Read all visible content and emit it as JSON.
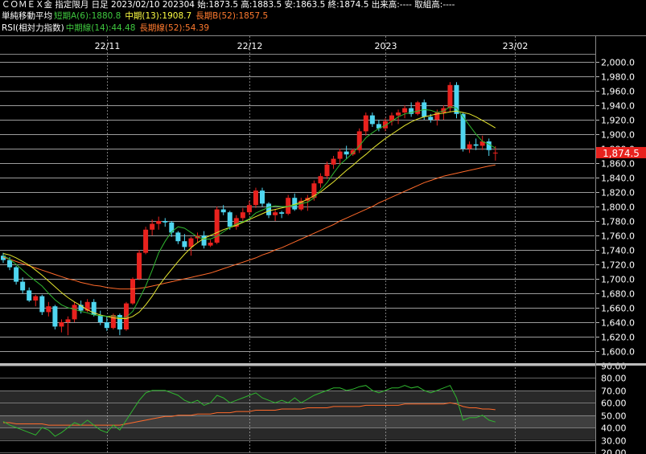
{
  "header": {
    "line1": "ＣＯＭＥＸ金 指定限月 日足 2023/02/10 202304 始:1873.5 高:1883.5 安:1863.5 終:1874.5 出来高:---- 取組高:----",
    "ma_label": "単純移動平均",
    "ma_short": "短期A(6):1880.8",
    "ma_mid": "中期(13):1908.7",
    "ma_long": "長期B(52):1857.5",
    "rsi_label": "RSI(相対力指数)",
    "rsi_value": "中期線(14):44.48",
    "rsi_signal": "長期線(52):54.39"
  },
  "colors": {
    "up": "#e8221e",
    "down": "#4fd6f0",
    "ma_short": "#2fb52f",
    "ma_mid": "#e6e62e",
    "ma_long": "#ff6a2a",
    "rsi": "#2fb52f",
    "rsi_long": "#ff6a2a",
    "price_tag": "#e8221e"
  },
  "chart_data": [
    {
      "type": "candlestick",
      "title": "ＣＯＭＥＸ金 指定限月 日足",
      "x_labels": [
        "22/11",
        "22/12",
        "2023",
        "23/02"
      ],
      "x_label_index": [
        17,
        39,
        60,
        80
      ],
      "ylim": [
        1600,
        2000
      ],
      "y_ticks": [
        2000,
        1980,
        1960,
        1940,
        1920,
        1900,
        1880,
        1860,
        1840,
        1820,
        1800,
        1780,
        1760,
        1740,
        1720,
        1700,
        1680,
        1660,
        1640,
        1620,
        1600
      ],
      "y_tick_labels": [
        "2,000.0",
        "1,980.0",
        "1,960.0",
        "1,940.0",
        "1,920.0",
        "1,900.0",
        "1,880.0",
        "1,860.0",
        "1,840.0",
        "1,820.0",
        "1,800.0",
        "1,780.0",
        "1,760.0",
        "1,740.0",
        "1,720.0",
        "1,700.0",
        "1,680.0",
        "1,660.0",
        "1,640.0",
        "1,620.0",
        "1,600.0"
      ],
      "last_price_label": "1,874.5",
      "candles": [
        [
          1,
          1732,
          1736,
          1722,
          1726
        ],
        [
          2,
          1726,
          1730,
          1712,
          1716
        ],
        [
          3,
          1716,
          1718,
          1692,
          1696
        ],
        [
          4,
          1696,
          1702,
          1680,
          1684
        ],
        [
          5,
          1684,
          1688,
          1668,
          1670
        ],
        [
          6,
          1670,
          1678,
          1662,
          1676
        ],
        [
          7,
          1676,
          1678,
          1650,
          1654
        ],
        [
          8,
          1654,
          1668,
          1648,
          1662
        ],
        [
          9,
          1662,
          1664,
          1630,
          1634
        ],
        [
          10,
          1634,
          1644,
          1626,
          1640
        ],
        [
          11,
          1640,
          1648,
          1622,
          1644
        ],
        [
          12,
          1644,
          1668,
          1640,
          1664
        ],
        [
          13,
          1664,
          1670,
          1652,
          1656
        ],
        [
          14,
          1656,
          1672,
          1654,
          1668
        ],
        [
          15,
          1668,
          1672,
          1648,
          1650
        ],
        [
          16,
          1650,
          1656,
          1636,
          1640
        ],
        [
          17,
          1640,
          1648,
          1628,
          1632
        ],
        [
          18,
          1632,
          1652,
          1630,
          1650
        ],
        [
          19,
          1650,
          1652,
          1622,
          1630
        ],
        [
          20,
          1630,
          1668,
          1628,
          1666
        ],
        [
          21,
          1666,
          1702,
          1664,
          1700
        ],
        [
          22,
          1700,
          1740,
          1698,
          1736
        ],
        [
          23,
          1736,
          1772,
          1734,
          1768
        ],
        [
          24,
          1768,
          1782,
          1760,
          1776
        ],
        [
          25,
          1776,
          1786,
          1768,
          1780
        ],
        [
          26,
          1780,
          1784,
          1772,
          1778
        ],
        [
          27,
          1778,
          1780,
          1758,
          1764
        ],
        [
          28,
          1764,
          1766,
          1748,
          1752
        ],
        [
          29,
          1752,
          1762,
          1740,
          1744
        ],
        [
          30,
          1744,
          1758,
          1732,
          1756
        ],
        [
          31,
          1756,
          1764,
          1750,
          1760
        ],
        [
          32,
          1760,
          1766,
          1742,
          1746
        ],
        [
          33,
          1746,
          1754,
          1744,
          1750
        ],
        [
          34,
          1750,
          1800,
          1748,
          1796
        ],
        [
          35,
          1796,
          1802,
          1788,
          1792
        ],
        [
          36,
          1792,
          1794,
          1768,
          1772
        ],
        [
          37,
          1772,
          1788,
          1768,
          1784
        ],
        [
          38,
          1784,
          1798,
          1780,
          1792
        ],
        [
          39,
          1792,
          1808,
          1788,
          1802
        ],
        [
          40,
          1802,
          1826,
          1798,
          1822
        ],
        [
          41,
          1822,
          1826,
          1800,
          1804
        ],
        [
          42,
          1804,
          1806,
          1784,
          1788
        ],
        [
          43,
          1788,
          1796,
          1780,
          1792
        ],
        [
          44,
          1792,
          1794,
          1784,
          1790
        ],
        [
          45,
          1790,
          1816,
          1788,
          1812
        ],
        [
          46,
          1812,
          1818,
          1794,
          1796
        ],
        [
          47,
          1796,
          1812,
          1794,
          1808
        ],
        [
          48,
          1808,
          1816,
          1794,
          1812
        ],
        [
          49,
          1812,
          1836,
          1808,
          1832
        ],
        [
          50,
          1832,
          1846,
          1826,
          1842
        ],
        [
          51,
          1842,
          1862,
          1838,
          1858
        ],
        [
          52,
          1858,
          1870,
          1852,
          1866
        ],
        [
          53,
          1866,
          1880,
          1858,
          1876
        ],
        [
          54,
          1876,
          1884,
          1866,
          1872
        ],
        [
          55,
          1872,
          1880,
          1870,
          1878
        ],
        [
          56,
          1878,
          1908,
          1874,
          1904
        ],
        [
          57,
          1904,
          1930,
          1898,
          1926
        ],
        [
          58,
          1926,
          1930,
          1910,
          1914
        ],
        [
          59,
          1914,
          1920,
          1904,
          1908
        ],
        [
          60,
          1908,
          1922,
          1904,
          1918
        ],
        [
          61,
          1918,
          1930,
          1912,
          1926
        ],
        [
          62,
          1926,
          1934,
          1914,
          1930
        ],
        [
          63,
          1930,
          1940,
          1922,
          1936
        ],
        [
          64,
          1936,
          1944,
          1924,
          1928
        ],
        [
          65,
          1928,
          1946,
          1926,
          1944
        ],
        [
          66,
          1944,
          1948,
          1920,
          1924
        ],
        [
          67,
          1924,
          1928,
          1916,
          1920
        ],
        [
          68,
          1920,
          1934,
          1912,
          1930
        ],
        [
          69,
          1930,
          1940,
          1920,
          1936
        ],
        [
          70,
          1936,
          1972,
          1930,
          1968
        ],
        [
          71,
          1968,
          1972,
          1922,
          1928
        ],
        [
          72,
          1928,
          1930,
          1876,
          1880
        ],
        [
          73,
          1880,
          1890,
          1874,
          1886
        ],
        [
          74,
          1886,
          1894,
          1878,
          1884
        ],
        [
          75,
          1884,
          1898,
          1878,
          1890
        ],
        [
          76,
          1890,
          1894,
          1870,
          1878
        ],
        [
          77,
          1873.5,
          1883.5,
          1863.5,
          1874.5
        ]
      ],
      "ma_short_values": [
        1732,
        1727,
        1720,
        1712,
        1704,
        1697,
        1690,
        1680,
        1671,
        1664,
        1660,
        1658,
        1655,
        1653,
        1650,
        1649,
        1648,
        1649,
        1646,
        1647,
        1655,
        1672,
        1690,
        1712,
        1736,
        1752,
        1765,
        1772,
        1770,
        1764,
        1758,
        1755,
        1755,
        1759,
        1765,
        1771,
        1776,
        1779,
        1783,
        1791,
        1795,
        1799,
        1801,
        1800,
        1800,
        1802,
        1804,
        1806,
        1812,
        1823,
        1833,
        1846,
        1858,
        1866,
        1874,
        1884,
        1895,
        1902,
        1908,
        1912,
        1918,
        1924,
        1928,
        1930,
        1932,
        1934,
        1933,
        1930,
        1932,
        1938,
        1936,
        1924,
        1912,
        1900,
        1890,
        1886,
        1880.8
      ],
      "ma_mid_values": [
        1735,
        1733,
        1729,
        1724,
        1719,
        1712,
        1705,
        1697,
        1689,
        1681,
        1674,
        1668,
        1663,
        1657,
        1653,
        1650,
        1648,
        1646,
        1645,
        1645,
        1648,
        1654,
        1664,
        1676,
        1690,
        1702,
        1713,
        1724,
        1734,
        1743,
        1750,
        1756,
        1760,
        1764,
        1768,
        1771,
        1774,
        1778,
        1782,
        1786,
        1790,
        1794,
        1796,
        1798,
        1800,
        1803,
        1806,
        1810,
        1815,
        1820,
        1827,
        1834,
        1842,
        1850,
        1857,
        1865,
        1872,
        1880,
        1887,
        1894,
        1900,
        1906,
        1912,
        1917,
        1921,
        1924,
        1926,
        1928,
        1929,
        1931,
        1932,
        1930,
        1928,
        1924,
        1919,
        1914,
        1908.7
      ],
      "ma_long_values": [
        1730,
        1727,
        1724,
        1721,
        1718,
        1715,
        1712,
        1709,
        1706,
        1703,
        1700,
        1698,
        1695,
        1693,
        1691,
        1690,
        1688,
        1687,
        1686,
        1686,
        1686,
        1687,
        1688,
        1690,
        1692,
        1694,
        1696,
        1698,
        1700,
        1702,
        1704,
        1706,
        1708,
        1711,
        1714,
        1717,
        1720,
        1723,
        1726,
        1729,
        1733,
        1736,
        1740,
        1743,
        1747,
        1751,
        1755,
        1759,
        1763,
        1767,
        1771,
        1775,
        1780,
        1784,
        1788,
        1792,
        1796,
        1800,
        1805,
        1809,
        1813,
        1817,
        1821,
        1825,
        1829,
        1833,
        1836,
        1839,
        1842,
        1844,
        1846,
        1848,
        1850,
        1852,
        1854,
        1856,
        1857.5
      ]
    },
    {
      "type": "line",
      "title": "RSI(相対力指数)",
      "ylim": [
        20,
        90
      ],
      "y_ticks": [
        90,
        80,
        70,
        60,
        50,
        40,
        30,
        20
      ],
      "y_tick_labels": [
        "90.00",
        "80.00",
        "70.00",
        "60.00",
        "50.00",
        "40.00",
        "30.00",
        "20.00"
      ],
      "bands": [
        [
          30,
          70
        ],
        [
          40,
          50
        ]
      ],
      "rsi_values": [
        45,
        42,
        40,
        38,
        36,
        34,
        40,
        38,
        33,
        36,
        40,
        44,
        42,
        46,
        42,
        38,
        36,
        42,
        38,
        46,
        54,
        62,
        68,
        70,
        70,
        70,
        68,
        66,
        62,
        60,
        62,
        58,
        60,
        66,
        64,
        60,
        62,
        64,
        66,
        68,
        64,
        62,
        60,
        62,
        60,
        64,
        60,
        63,
        66,
        68,
        70,
        72,
        72,
        70,
        71,
        73,
        74,
        70,
        68,
        70,
        72,
        72,
        74,
        72,
        73,
        70,
        68,
        70,
        72,
        74,
        64,
        46,
        48,
        48,
        50,
        46,
        44.48
      ],
      "rsi_long_values": [
        44,
        44,
        43,
        43,
        43,
        43,
        43,
        42,
        42,
        42,
        42,
        42,
        42,
        42,
        42,
        42,
        42,
        42,
        42,
        43,
        44,
        45,
        46,
        47,
        48,
        49,
        49,
        50,
        50,
        50,
        51,
        51,
        51,
        52,
        52,
        52,
        53,
        53,
        53,
        54,
        54,
        54,
        54,
        55,
        55,
        55,
        55,
        56,
        56,
        56,
        56,
        57,
        57,
        57,
        57,
        57,
        58,
        58,
        58,
        58,
        58,
        58,
        59,
        59,
        59,
        59,
        59,
        59,
        59,
        60,
        59,
        57,
        56,
        56,
        55,
        55,
        54.39
      ]
    }
  ]
}
